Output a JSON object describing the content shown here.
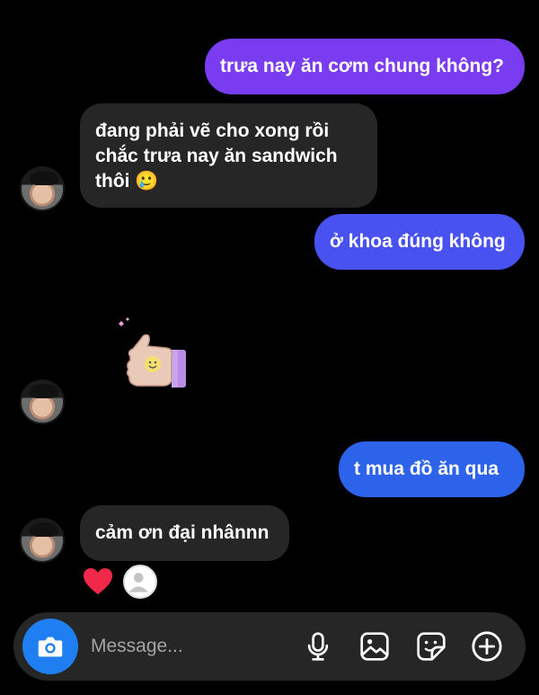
{
  "messages": [
    {
      "id": "b1",
      "direction": "outgoing",
      "text": "trưa nay ăn cơm chung không?"
    },
    {
      "id": "b2",
      "direction": "incoming",
      "text": "đang phải vẽ cho xong rồi\nchắc trưa nay ăn sandwich\nthôi 🥲"
    },
    {
      "id": "b3",
      "direction": "outgoing",
      "text": "ở khoa đúng không"
    },
    {
      "id": "sticker",
      "direction": "incoming",
      "sticker": "thumbs-up-sticker"
    },
    {
      "id": "b4",
      "direction": "outgoing",
      "text": "t mua đồ ăn qua"
    },
    {
      "id": "b5",
      "direction": "incoming",
      "text": "cảm ơn đại nhânnn"
    }
  ],
  "reaction": {
    "icon": "heart-icon",
    "color": "#f02849"
  },
  "colors": {
    "outgoing_top": "#7a3cf0",
    "outgoing_mid": "#4852f1",
    "outgoing_bottom": "#2c63ea",
    "incoming": "#262626",
    "camera": "#1f7ff2"
  },
  "composer": {
    "placeholder": "Message...",
    "icons": [
      "camera-icon",
      "microphone-icon",
      "gallery-icon",
      "sticker-icon",
      "plus-circle-icon"
    ]
  }
}
